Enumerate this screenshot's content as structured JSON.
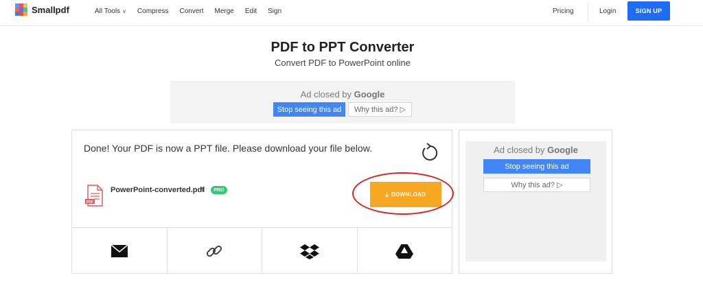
{
  "header": {
    "logo_text": "Smallpdf",
    "logo_colors": [
      "#4da3e8",
      "#e84c8b",
      "#f5c241",
      "#f26a3a",
      "#8a5cd6",
      "#37c9a6",
      "#2f80ed",
      "#ef4b4b",
      "#f7a823"
    ],
    "nav": [
      {
        "label": "All Tools",
        "has_dropdown": true
      },
      {
        "label": "Compress"
      },
      {
        "label": "Convert"
      },
      {
        "label": "Merge"
      },
      {
        "label": "Edit"
      },
      {
        "label": "Sign"
      }
    ],
    "pricing": "Pricing",
    "login": "Login",
    "signup": "SIGN UP"
  },
  "page": {
    "title": "PDF to PPT Converter",
    "subtitle": "Convert PDF to PowerPoint online"
  },
  "ad_top": {
    "closed_prefix": "Ad closed by ",
    "closed_brand": "Google",
    "stop_label": "Stop seeing this ad",
    "why_label": "Why this ad? ▷"
  },
  "result": {
    "message": "Done! Your PDF is now a PPT file. Please download your file below.",
    "file_name": "PowerPoint-converted.pdf",
    "file_badge": "PDF",
    "pro_badge": "PRO",
    "download_label": "DOWNLOAD",
    "share_options": [
      "email-icon",
      "link-icon",
      "dropbox-icon",
      "google-drive-icon"
    ]
  },
  "ad_side": {
    "closed_prefix": "Ad closed by ",
    "closed_brand": "Google",
    "stop_label": "Stop seeing this ad",
    "why_label": "Why this ad? ▷"
  },
  "colors": {
    "accent_blue": "#1f6cf3",
    "download_orange": "#f7a823",
    "pro_green": "#2ecc71",
    "highlight_red": "#e02020",
    "google_blue": "#4285f4"
  }
}
